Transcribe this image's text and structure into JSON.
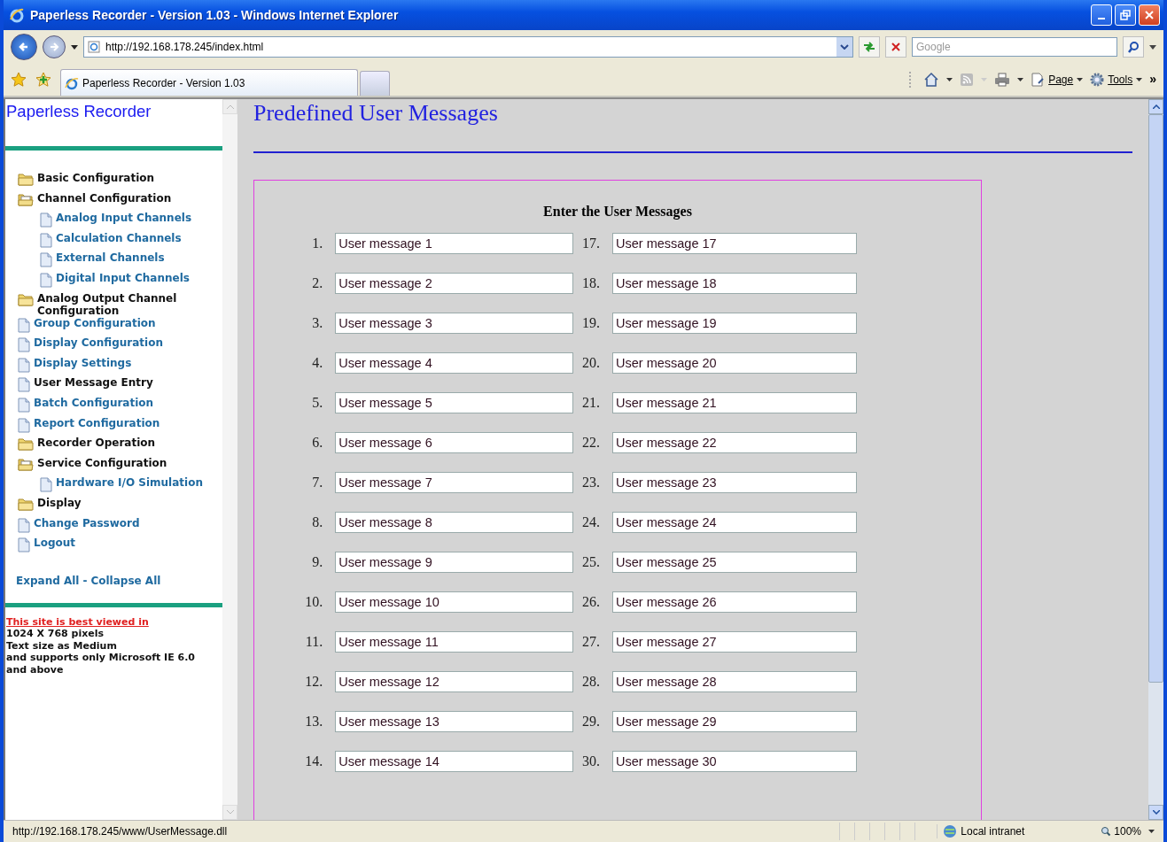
{
  "window": {
    "title": "Paperless Recorder - Version 1.03 - Windows Internet Explorer"
  },
  "address_bar": {
    "url": "http://192.168.178.245/index.html",
    "search_placeholder": "Google"
  },
  "tabs": [
    {
      "label": "Paperless Recorder - Version 1.03",
      "selected": true
    }
  ],
  "command_bar": {
    "page_menu": "Page",
    "tools_menu": "Tools",
    "chevron": "»"
  },
  "sidebar": {
    "title": "Paperless Recorder",
    "tree": [
      {
        "label": "Basic Configuration",
        "kind": "folder",
        "expanded": false
      },
      {
        "label": "Channel Configuration",
        "kind": "folder",
        "expanded": true,
        "children": [
          {
            "label": "Analog Input Channels",
            "kind": "page",
            "selected": false
          },
          {
            "label": "Calculation Channels",
            "kind": "page",
            "selected": false
          },
          {
            "label": "External Channels",
            "kind": "page",
            "selected": false
          },
          {
            "label": "Digital Input Channels",
            "kind": "page",
            "selected": false
          }
        ]
      },
      {
        "label": "Analog Output Channel Configuration",
        "kind": "folder",
        "expanded": false
      },
      {
        "label": "Group Configuration",
        "kind": "page",
        "selected": false
      },
      {
        "label": "Display Configuration",
        "kind": "page",
        "selected": false
      },
      {
        "label": "Display Settings",
        "kind": "page",
        "selected": false
      },
      {
        "label": "User Message Entry",
        "kind": "page",
        "selected": true
      },
      {
        "label": "Batch Configuration",
        "kind": "page",
        "selected": false
      },
      {
        "label": "Report Configuration",
        "kind": "page",
        "selected": false
      },
      {
        "label": "Recorder Operation",
        "kind": "folder",
        "expanded": false
      },
      {
        "label": "Service Configuration",
        "kind": "folder",
        "expanded": true,
        "children": [
          {
            "label": "Hardware I/O Simulation",
            "kind": "page",
            "selected": false
          }
        ]
      },
      {
        "label": "Display",
        "kind": "folder",
        "expanded": false
      },
      {
        "label": "Change Password",
        "kind": "page",
        "selected": false
      },
      {
        "label": "Logout",
        "kind": "page",
        "selected": false
      }
    ],
    "expand_all": "Expand All",
    "separator": "-",
    "collapse_all": "Collapse All",
    "notice_link": "This site is best viewed in",
    "notice_lines": [
      "1024 X 768 pixels",
      "Text size as Medium",
      "and supports only Microsoft IE 6.0",
      "and above"
    ]
  },
  "page": {
    "heading": "Predefined User Messages",
    "form_title": "Enter the User Messages",
    "columns": [
      {
        "messages": [
          {
            "number": "1.",
            "value": "User message 1"
          },
          {
            "number": "2.",
            "value": "User message 2"
          },
          {
            "number": "3.",
            "value": "User message 3"
          },
          {
            "number": "4.",
            "value": "User message 4"
          },
          {
            "number": "5.",
            "value": "User message 5"
          },
          {
            "number": "6.",
            "value": "User message 6"
          },
          {
            "number": "7.",
            "value": "User message 7"
          },
          {
            "number": "8.",
            "value": "User message 8"
          },
          {
            "number": "9.",
            "value": "User message 9"
          },
          {
            "number": "10.",
            "value": "User message 10"
          },
          {
            "number": "11.",
            "value": "User message 11"
          },
          {
            "number": "12.",
            "value": "User message 12"
          },
          {
            "number": "13.",
            "value": "User message 13"
          },
          {
            "number": "14.",
            "value": "User message 14"
          }
        ]
      },
      {
        "messages": [
          {
            "number": "17.",
            "value": "User message 17"
          },
          {
            "number": "18.",
            "value": "User message 18"
          },
          {
            "number": "19.",
            "value": "User message 19"
          },
          {
            "number": "20.",
            "value": "User message 20"
          },
          {
            "number": "21.",
            "value": "User message 21"
          },
          {
            "number": "22.",
            "value": "User message 22"
          },
          {
            "number": "23.",
            "value": "User message 23"
          },
          {
            "number": "24.",
            "value": "User message 24"
          },
          {
            "number": "25.",
            "value": "User message 25"
          },
          {
            "number": "26.",
            "value": "User message 26"
          },
          {
            "number": "27.",
            "value": "User message 27"
          },
          {
            "number": "28.",
            "value": "User message 28"
          },
          {
            "number": "29.",
            "value": "User message 29"
          },
          {
            "number": "30.",
            "value": "User message 30"
          }
        ]
      }
    ]
  },
  "status_bar": {
    "url": "http://192.168.178.245/www/UserMessage.dll",
    "zone": "Local intranet",
    "zoom": "100%"
  }
}
